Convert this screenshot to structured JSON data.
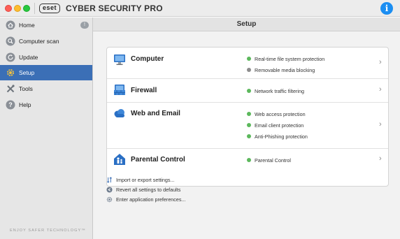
{
  "window": {
    "logo_text": "eset",
    "app_title": "CYBER SECURITY PRO",
    "info_glyph": "i"
  },
  "sidebar": {
    "items": [
      {
        "label": "Home",
        "icon": "home-icon",
        "badge": "!"
      },
      {
        "label": "Computer scan",
        "icon": "scan-icon"
      },
      {
        "label": "Update",
        "icon": "update-icon"
      },
      {
        "label": "Setup",
        "icon": "setup-icon",
        "active": true
      },
      {
        "label": "Tools",
        "icon": "tools-icon"
      },
      {
        "label": "Help",
        "icon": "help-icon"
      }
    ],
    "slogan": "ENJOY SAFER TECHNOLOGY™"
  },
  "main": {
    "title": "Setup",
    "sections": [
      {
        "title": "Computer",
        "icon": "computer-icon",
        "features": [
          {
            "label": "Real-time file system protection",
            "status": "on"
          },
          {
            "label": "Removable media blocking",
            "status": "off"
          }
        ]
      },
      {
        "title": "Firewall",
        "icon": "firewall-icon",
        "features": [
          {
            "label": "Network traffic filtering",
            "status": "on"
          }
        ]
      },
      {
        "title": "Web and Email",
        "icon": "cloud-icon",
        "features": [
          {
            "label": "Web access protection",
            "status": "on"
          },
          {
            "label": "Email client protection",
            "status": "on"
          },
          {
            "label": "Anti-Phishing protection",
            "status": "on"
          }
        ]
      },
      {
        "title": "Parental Control",
        "icon": "parental-control-icon",
        "features": [
          {
            "label": "Parental Control",
            "status": "on"
          }
        ]
      }
    ],
    "actions": [
      {
        "label": "Import or export settings...",
        "icon": "import-export-icon"
      },
      {
        "label": "Revert all settings to defaults",
        "icon": "revert-icon"
      },
      {
        "label": "Enter application preferences...",
        "icon": "preferences-gear-icon"
      }
    ]
  },
  "colors": {
    "accent": "#3b6fb6",
    "status_on": "#5cb85c",
    "status_off": "#8d8d8d",
    "info": "#1b8ef2"
  }
}
